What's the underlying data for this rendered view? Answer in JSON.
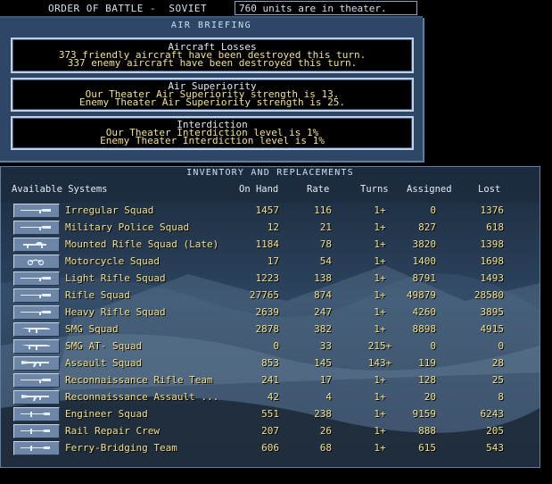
{
  "title_bar": {
    "title": "ORDER OF BATTLE -  SOVIET",
    "units_text": "760 units are in theater."
  },
  "air_briefing": {
    "heading": "AIR BRIEFING",
    "sections": [
      {
        "title": "Aircraft Losses",
        "lines": [
          "373 friendly aircraft have been destroyed this turn.",
          "337 enemy aircraft have been destroyed this turn."
        ]
      },
      {
        "title": "Air Superiority",
        "lines": [
          "Our Theater Air Superiority strength is 13.",
          "Enemy Theater Air Superiority strength is 25."
        ]
      },
      {
        "title": "Interdiction",
        "lines": [
          "Our Theater Interdiction level is 1%",
          "Enemy Theater Interdiction level is 1%"
        ]
      }
    ]
  },
  "inventory": {
    "heading": "INVENTORY AND REPLACEMENTS",
    "columns": {
      "systems": "Available Systems",
      "on_hand": "On Hand",
      "rate": "Rate",
      "turns": "Turns",
      "assigned": "Assigned",
      "lost": "Lost"
    },
    "rows": [
      {
        "name": "Irregular Squad",
        "on_hand": "1457",
        "rate": "116",
        "turns": "1+",
        "assigned": "0",
        "lost": "1376",
        "icon": "rifle-icon"
      },
      {
        "name": "Military Police Squad",
        "on_hand": "12",
        "rate": "21",
        "turns": "1+",
        "assigned": "827",
        "lost": "618",
        "icon": "rifle-icon"
      },
      {
        "name": "Mounted Rifle Squad (Late)",
        "on_hand": "1184",
        "rate": "78",
        "turns": "1+",
        "assigned": "3820",
        "lost": "1398",
        "icon": "cavalry-icon"
      },
      {
        "name": "Motorcycle Squad",
        "on_hand": "17",
        "rate": "54",
        "turns": "1+",
        "assigned": "1400",
        "lost": "1698",
        "icon": "motorcycle-icon"
      },
      {
        "name": "Light Rifle Squad",
        "on_hand": "1223",
        "rate": "138",
        "turns": "1+",
        "assigned": "8791",
        "lost": "1493",
        "icon": "rifle-icon"
      },
      {
        "name": "Rifle Squad",
        "on_hand": "27765",
        "rate": "874",
        "turns": "1+",
        "assigned": "49879",
        "lost": "28580",
        "icon": "rifle-icon"
      },
      {
        "name": "Heavy Rifle Squad",
        "on_hand": "2639",
        "rate": "247",
        "turns": "1+",
        "assigned": "4260",
        "lost": "3895",
        "icon": "rifle-icon"
      },
      {
        "name": "SMG Squad",
        "on_hand": "2878",
        "rate": "382",
        "turns": "1+",
        "assigned": "8898",
        "lost": "4915",
        "icon": "smg-icon"
      },
      {
        "name": "SMG AT- Squad",
        "on_hand": "0",
        "rate": "33",
        "turns": "215+",
        "assigned": "0",
        "lost": "0",
        "icon": "smg-icon"
      },
      {
        "name": "Assault Squad",
        "on_hand": "853",
        "rate": "145",
        "turns": "143+",
        "assigned": "119",
        "lost": "28",
        "icon": "assault-rifle-icon"
      },
      {
        "name": "Reconnaissance Rifle Team",
        "on_hand": "241",
        "rate": "17",
        "turns": "1+",
        "assigned": "128",
        "lost": "25",
        "icon": "rifle-icon"
      },
      {
        "name": "Reconnaissance Assault ...",
        "on_hand": "42",
        "rate": "4",
        "turns": "1+",
        "assigned": "20",
        "lost": "8",
        "icon": "assault-rifle-icon"
      },
      {
        "name": "Engineer Squad",
        "on_hand": "551",
        "rate": "238",
        "turns": "1+",
        "assigned": "9159",
        "lost": "6243",
        "icon": "engineer-icon"
      },
      {
        "name": "Rail Repair Crew",
        "on_hand": "207",
        "rate": "26",
        "turns": "1+",
        "assigned": "888",
        "lost": "205",
        "icon": "engineer-icon"
      },
      {
        "name": "Ferry-Bridging Team",
        "on_hand": "606",
        "rate": "68",
        "turns": "1+",
        "assigned": "615",
        "lost": "543",
        "icon": "engineer-icon"
      }
    ]
  },
  "colors": {
    "panel_blue": "#2e4766",
    "text_yellow": "#f2e28a",
    "text_white": "#dde8f4",
    "button_blue": "#6d86a8"
  }
}
